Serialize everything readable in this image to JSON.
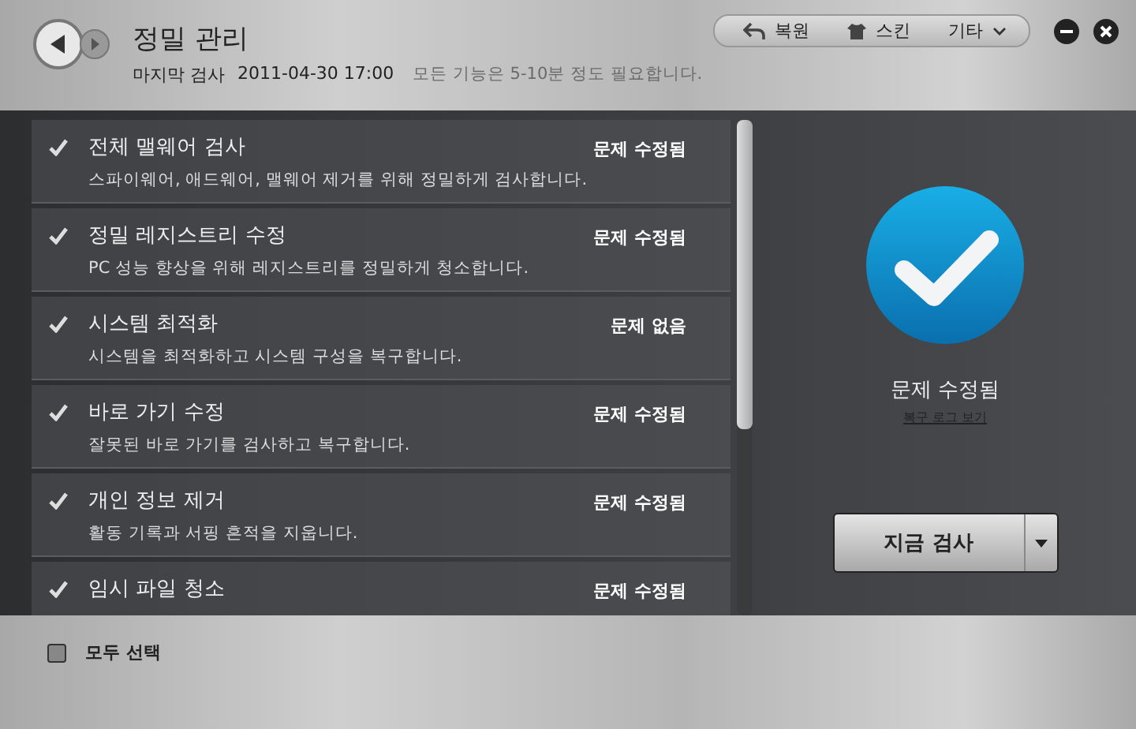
{
  "window": {
    "title": "정밀 관리",
    "last_scan_label": "마지막 검사",
    "last_scan_time": "2011-04-30 17:00",
    "hint": "모든 기능은 5-10분 정도 필요합니다."
  },
  "toolbar": [
    {
      "kind": "restore",
      "label": "복원"
    },
    {
      "kind": "skin",
      "label": "스킨"
    },
    {
      "kind": "more",
      "label": "기타"
    }
  ],
  "tasks": [
    {
      "title": "전체 맬웨어 검사",
      "description": "스파이웨어, 애드웨어, 맬웨어 제거를 위해 정밀하게 검사합니다.",
      "status": "문제 수정됨",
      "checked": true
    },
    {
      "title": "정밀 레지스트리 수정",
      "description": "PC 성능 향상을 위해 레지스트리를 정밀하게 청소합니다.",
      "status": "문제 수정됨",
      "checked": true
    },
    {
      "title": "시스템 최적화",
      "description": "시스템을 최적화하고 시스템 구성을 복구합니다.",
      "status": "문제 없음",
      "checked": true
    },
    {
      "title": "바로 가기 수정",
      "description": "잘못된 바로 가기를 검사하고 복구합니다.",
      "status": "문제 수정됨",
      "checked": true
    },
    {
      "title": "개인 정보 제거",
      "description": "활동 기록과 서핑 흔적을 지웁니다.",
      "status": "문제 수정됨",
      "checked": true
    },
    {
      "title": "임시 파일 청소",
      "status": "문제 수정됨",
      "checked": true
    }
  ],
  "result": {
    "status": "문제 수정됨",
    "link": "복구 로그 보기"
  },
  "scan_button": {
    "label": "지금 검사"
  },
  "select_all": {
    "label": "모두 선택",
    "checked": false
  }
}
